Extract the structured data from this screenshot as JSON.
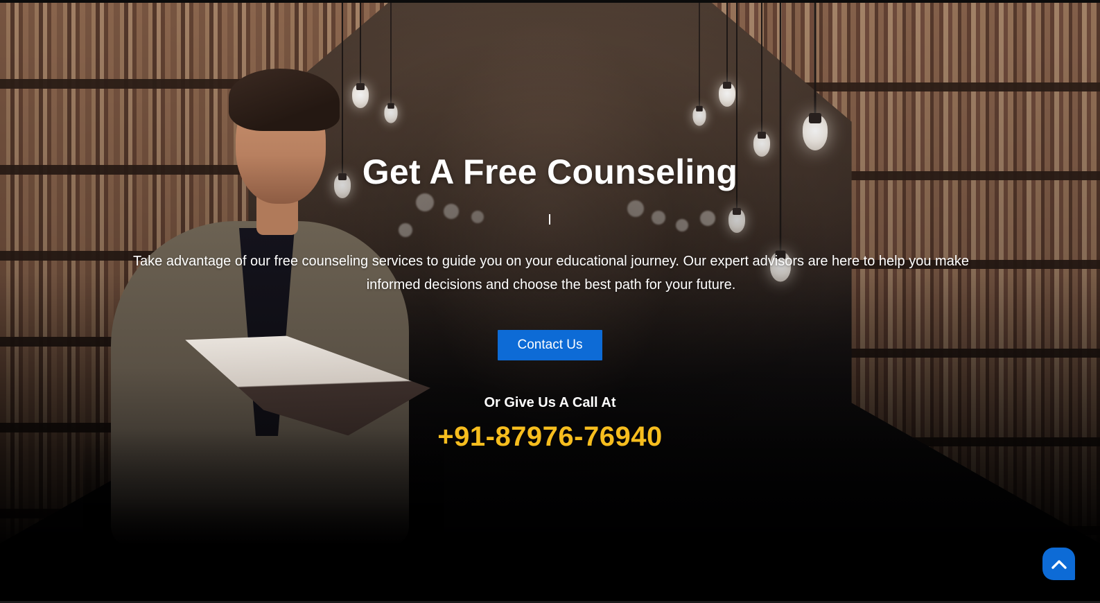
{
  "hero": {
    "heading": "Get A Free Counseling",
    "description": "Take advantage of our free counseling services to guide you on your educational journey. Our expert advisors are here to help you make informed decisions and choose the best path for your future.",
    "cta_label": "Contact Us",
    "call_label": "Or Give Us A Call At",
    "phone": "+91-87976-76940"
  },
  "colors": {
    "accent_blue": "#0d6bd6",
    "phone_yellow": "#f6bd1e",
    "text": "#ffffff",
    "background_bottom": "#000000"
  },
  "icons": {
    "scroll_top": "chevron-up-icon"
  }
}
